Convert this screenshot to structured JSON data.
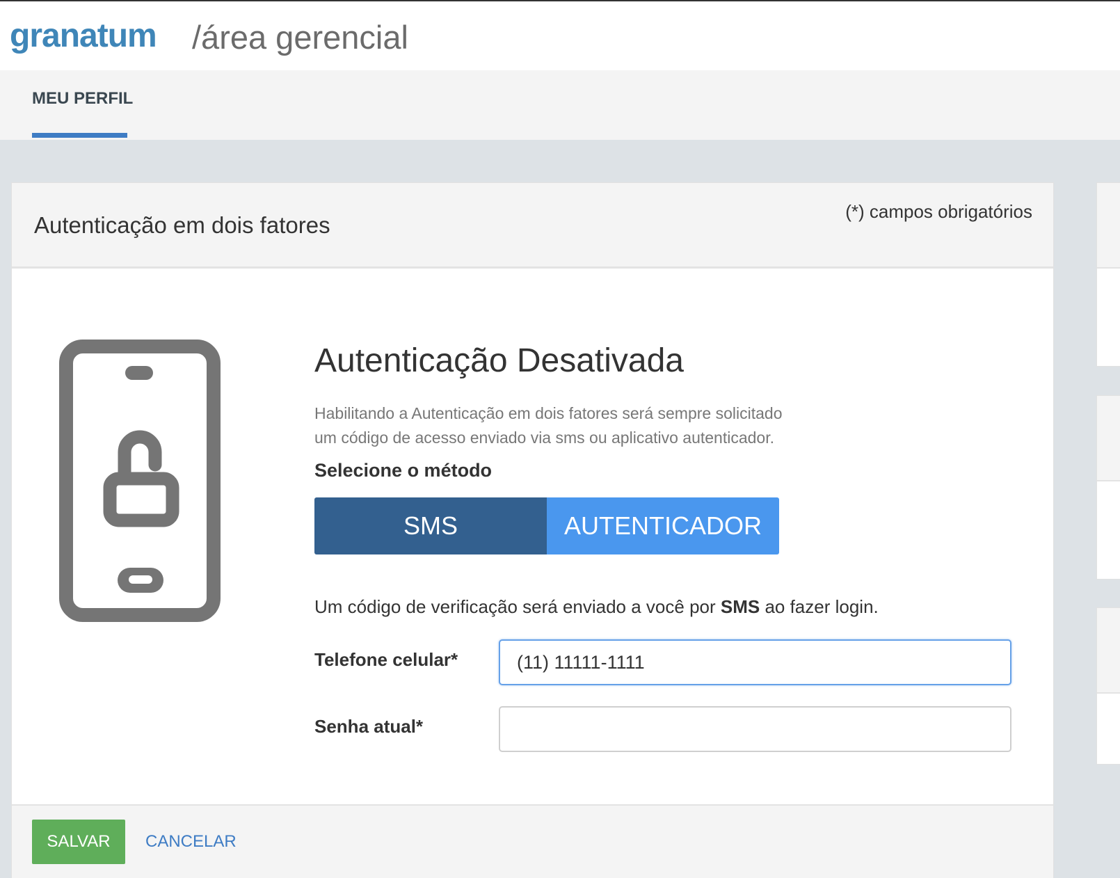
{
  "header": {
    "logo": "granatum",
    "area_title": "/área gerencial"
  },
  "tabs": [
    {
      "label": "MEU PERFIL",
      "active": true
    }
  ],
  "card": {
    "title": "Autenticação em dois fatores",
    "required_note": "(*) campos obrigatórios",
    "status_title": "Autenticação Desativada",
    "description": "Habilitando a Autenticação em dois fatores será sempre solicitado um código de acesso enviado via sms ou aplicativo autenticador.",
    "method_label": "Selecione o método",
    "methods": {
      "sms": "SMS",
      "authenticator": "AUTENTICADOR",
      "selected": "SMS"
    },
    "info": {
      "before": "Um código de verificação será enviado a você por ",
      "bold": "SMS",
      "after": " ao fazer login."
    },
    "fields": {
      "phone_label": "Telefone celular*",
      "phone_value": "(11) 11111-1111",
      "password_label": "Senha atual*",
      "password_value": ""
    },
    "icon": "phone-unlocked-icon"
  },
  "footer": {
    "save": "SALVAR",
    "cancel": "CANCELAR"
  },
  "colors": {
    "brand": "#3f86b8",
    "tab_accent": "#3e7cc4",
    "sms_selected": "#33608f",
    "authenticator": "#4a97ee",
    "save_button": "#5fae5a"
  }
}
